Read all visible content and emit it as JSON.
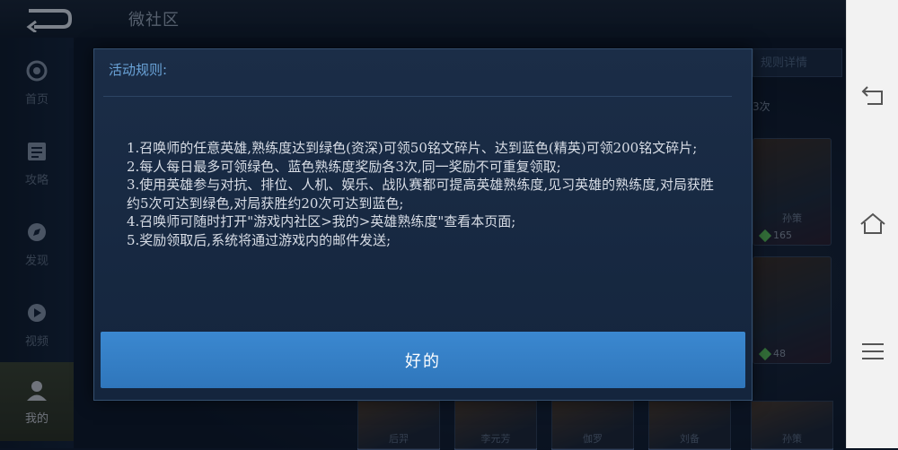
{
  "app": {
    "title": "微社区"
  },
  "sidebar": {
    "items": [
      {
        "label": "首页",
        "icon": "home-icon"
      },
      {
        "label": "攻略",
        "icon": "guide-icon"
      },
      {
        "label": "发现",
        "icon": "discover-icon"
      },
      {
        "label": "视频",
        "icon": "video-icon"
      },
      {
        "label": "我的",
        "icon": "profile-icon",
        "active": true
      }
    ]
  },
  "background": {
    "right_tab": "规则详情",
    "right_count": "3次",
    "hero_cards": [
      {
        "name": "孙策",
        "value": "165"
      },
      {
        "name": "",
        "value": "48"
      }
    ],
    "bottom_cards": [
      "后羿",
      "李元芳",
      "伽罗",
      "刘备",
      "孙策"
    ]
  },
  "dialog": {
    "title": "活动规则:",
    "rules": [
      "1.召唤师的任意英雄,熟练度达到绿色(资深)可领50铭文碎片、达到蓝色(精英)可领200铭文碎片;",
      "2.每人每日最多可领绿色、蓝色熟练度奖励各3次,同一奖励不可重复领取;",
      "3.使用英雄参与对抗、排位、人机、娱乐、战队赛都可提高英雄熟练度,见习英雄的熟练度,对局获胜约5次可达到绿色,对局获胜约20次可达到蓝色;",
      "4.召唤师可随时打开\"游戏内社区>我的>英雄熟练度\"查看本页面;",
      "5.奖励领取后,系统将通过游戏内的邮件发送;"
    ],
    "ok_label": "好的"
  },
  "colors": {
    "accent": "#3b88d0",
    "dialog_bg": "#1b2d47",
    "title": "#6aa3d8"
  }
}
